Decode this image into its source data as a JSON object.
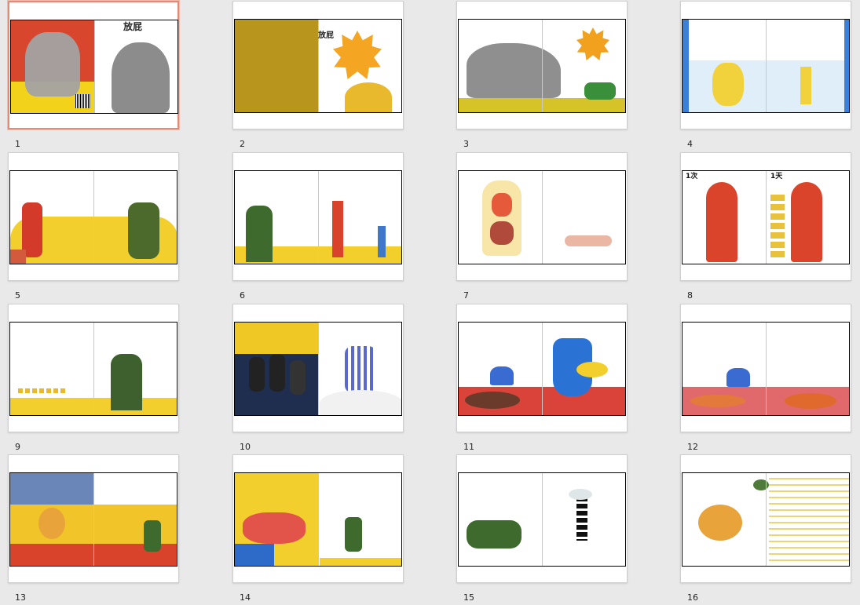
{
  "thumbnails": [
    {
      "page": "1",
      "title": "放屁",
      "selected": true
    },
    {
      "page": "2",
      "title": "放屁",
      "selected": false
    },
    {
      "page": "3",
      "selected": false
    },
    {
      "page": "4",
      "selected": false
    },
    {
      "page": "5",
      "selected": false
    },
    {
      "page": "6",
      "selected": false
    },
    {
      "page": "7",
      "selected": false
    },
    {
      "page": "8",
      "label_left": "1次",
      "label_right": "1天",
      "selected": false
    },
    {
      "page": "9",
      "selected": false
    },
    {
      "page": "10",
      "selected": false
    },
    {
      "page": "11",
      "selected": false
    },
    {
      "page": "12",
      "selected": false
    },
    {
      "page": "13",
      "selected": false
    },
    {
      "page": "14",
      "selected": false
    },
    {
      "page": "15",
      "selected": false
    },
    {
      "page": "16",
      "selected": false
    }
  ],
  "colors": {
    "background": "#e9e9e9",
    "selected_border": "#e38a74"
  }
}
